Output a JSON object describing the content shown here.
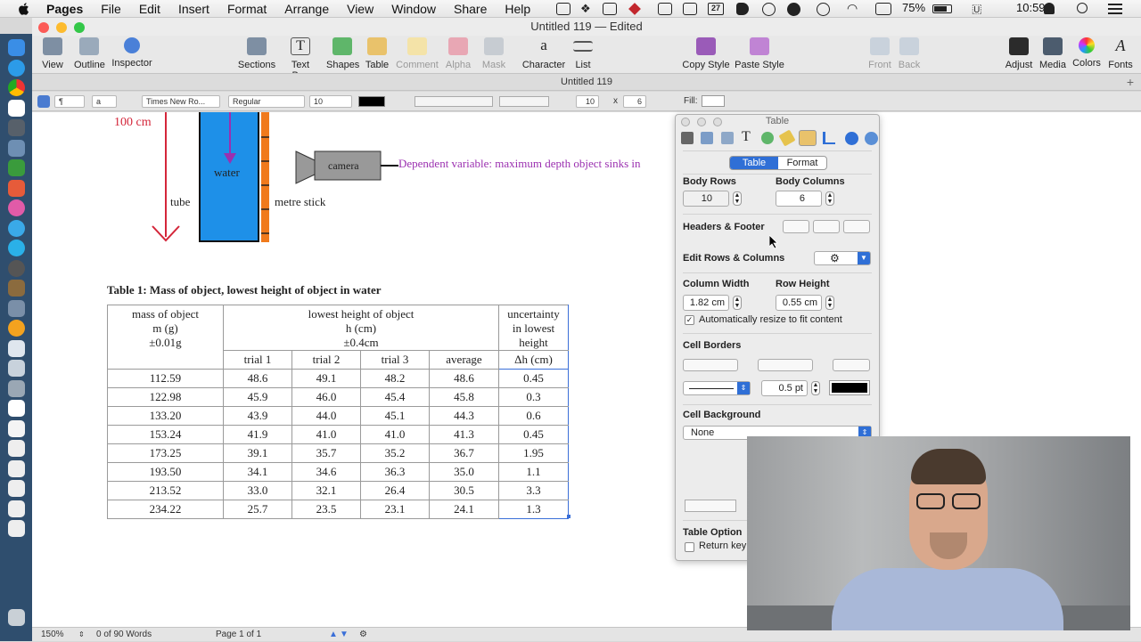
{
  "menubar": {
    "app": "Pages",
    "items": [
      "File",
      "Edit",
      "Insert",
      "Format",
      "Arrange",
      "View",
      "Window",
      "Share",
      "Help"
    ],
    "status_badge": "27",
    "battery": "75%",
    "time": "10:59"
  },
  "window": {
    "title": "Untitled 119 — Edited",
    "tab_title": "Untitled 119"
  },
  "toolbar": {
    "left": [
      {
        "label": "View",
        "icon": "view-icon"
      },
      {
        "label": "Outline",
        "icon": "outline-icon"
      },
      {
        "label": "Inspector",
        "icon": "info-icon"
      }
    ],
    "center": [
      {
        "label": "Sections",
        "icon": "sections-icon"
      },
      {
        "label": "Text Box",
        "icon": "textbox-icon"
      },
      {
        "label": "Shapes",
        "icon": "shapes-icon"
      },
      {
        "label": "Table",
        "icon": "table-icon"
      },
      {
        "label": "Comment",
        "icon": "comment-icon"
      },
      {
        "label": "Alpha",
        "icon": "alpha-icon"
      },
      {
        "label": "Mask",
        "icon": "mask-icon"
      },
      {
        "label": "Character",
        "icon": "character-icon"
      },
      {
        "label": "List",
        "icon": "list-icon"
      }
    ],
    "style": [
      {
        "label": "Copy Style",
        "icon": "copy-style-icon"
      },
      {
        "label": "Paste Style",
        "icon": "paste-style-icon"
      }
    ],
    "arrange": [
      {
        "label": "Front",
        "icon": "front-icon"
      },
      {
        "label": "Back",
        "icon": "back-icon"
      }
    ],
    "right": [
      {
        "label": "Adjust",
        "icon": "adjust-icon"
      },
      {
        "label": "Media",
        "icon": "media-icon"
      },
      {
        "label": "Colors",
        "icon": "colors-icon"
      },
      {
        "label": "Fonts",
        "icon": "fonts-icon"
      }
    ]
  },
  "formatbar": {
    "para_style": "¶",
    "char_style": "a",
    "font": "Times New Ro...",
    "typeface": "Regular",
    "size": "10",
    "rows": "10",
    "times": "x",
    "cols": "6",
    "fill_label": "Fill:"
  },
  "figure": {
    "height_label": "100 cm",
    "water": "water",
    "tube": "tube",
    "metre_stick": "metre stick",
    "camera": "camera",
    "dependent": "Dependent variable: maximum depth object sinks in"
  },
  "table": {
    "caption": "Table 1: Mass of object, lowest height of object in water",
    "header": {
      "mass": [
        "mass of object",
        "m (g)",
        "±0.01g"
      ],
      "height": [
        "lowest height of object",
        "h (cm)",
        "±0.4cm"
      ],
      "uncertainty": [
        "uncertainty",
        "in lowest",
        "height"
      ],
      "sub": [
        "trial 1",
        "trial 2",
        "trial 3",
        "average",
        "Δh (cm)"
      ]
    },
    "rows": [
      [
        "112.59",
        "48.6",
        "49.1",
        "48.2",
        "48.6",
        "0.45"
      ],
      [
        "122.98",
        "45.9",
        "46.0",
        "45.4",
        "45.8",
        "0.3"
      ],
      [
        "133.20",
        "43.9",
        "44.0",
        "45.1",
        "44.3",
        "0.6"
      ],
      [
        "153.24",
        "41.9",
        "41.0",
        "41.0",
        "41.3",
        "0.45"
      ],
      [
        "173.25",
        "39.1",
        "35.7",
        "35.2",
        "36.7",
        "1.95"
      ],
      [
        "193.50",
        "34.1",
        "34.6",
        "36.3",
        "35.0",
        "1.1"
      ],
      [
        "213.52",
        "33.0",
        "32.1",
        "26.4",
        "30.5",
        "3.3"
      ],
      [
        "234.22",
        "25.7",
        "23.5",
        "23.1",
        "24.1",
        "1.3"
      ]
    ]
  },
  "inspector": {
    "title": "Table",
    "tabs": [
      "Table",
      "Format"
    ],
    "body_rows_label": "Body Rows",
    "body_rows": "10",
    "body_cols_label": "Body Columns",
    "body_cols": "6",
    "headers_footer": "Headers & Footer",
    "edit_rows_cols": "Edit Rows & Columns",
    "col_width_label": "Column Width",
    "col_width": "1.82 cm",
    "row_height_label": "Row Height",
    "row_height": "0.55 cm",
    "auto_resize": "Automatically resize to fit content",
    "cell_borders": "Cell Borders",
    "border_width": "0.5 pt",
    "cell_background": "Cell Background",
    "background_value": "None",
    "table_options": "Table Option",
    "return_key": "Return key"
  },
  "status": {
    "zoom": "150%",
    "words": "0 of 90 Words",
    "page": "Page 1 of 1"
  },
  "colors": {
    "accent": "#2f6fd6",
    "water": "#1e90e8",
    "stick": "#f07a1c",
    "arrow": "#d4263a",
    "purple_label": "#9b30b0"
  }
}
